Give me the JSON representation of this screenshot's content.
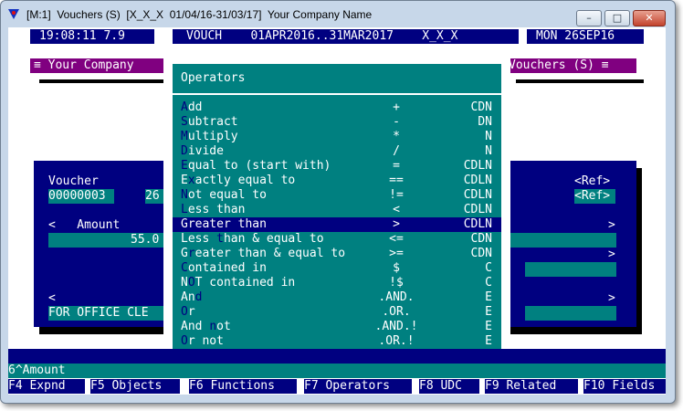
{
  "window": {
    "title": "[M:1]  Vouchers (S)  [X_X_X  01/04/16-31/03/17]  Your Company Name",
    "buttons": {
      "minimize": "–",
      "maximize": "□",
      "close": "✕"
    }
  },
  "status_bar": {
    "time": "19:08:11 7.9",
    "context": "VOUCH    01APR2016..31MAR2017    X_X_X",
    "date": "MON 26SEP16"
  },
  "company_header": "≡ Your Company",
  "vouchers_header": "Vouchers (S) ≡",
  "form": {
    "voucher_label": "Voucher",
    "voucher_value": "00000003",
    "voucher_value2": "26",
    "ref_label": "<Ref>",
    "ref_value": "<Ref>",
    "amount_label": "<   Amount",
    "amount_right": ">",
    "amount_value": "55.0",
    "row_left_arrow": "<",
    "row_right_arrow": ">",
    "office_text": "FOR OFFICE CLE"
  },
  "operators": {
    "title": "Operators",
    "items": [
      {
        "hot": "A",
        "rest": "dd",
        "symbol": "+",
        "codes": "CDN",
        "selected": false
      },
      {
        "hot": "S",
        "rest": "ubtract",
        "symbol": "-",
        "codes": "DN",
        "selected": false
      },
      {
        "hot": "M",
        "rest": "ultiply",
        "symbol": "*",
        "codes": "N",
        "selected": false
      },
      {
        "hot": "D",
        "rest": "ivide",
        "symbol": "/",
        "codes": "N",
        "selected": false
      },
      {
        "hot": "E",
        "rest": "qual to (start with)",
        "symbol": "=",
        "codes": "CDLN",
        "selected": false
      },
      {
        "pre": "E",
        "hot": "x",
        "rest": "actly equal to",
        "symbol": "==",
        "codes": "CDLN",
        "selected": false
      },
      {
        "hot": "N",
        "rest": "ot equal to",
        "symbol": "!=",
        "codes": "CDLN",
        "selected": false
      },
      {
        "hot": "L",
        "rest": "ess than",
        "symbol": "<",
        "codes": "CDLN",
        "selected": false
      },
      {
        "hot": "G",
        "rest": "reater than",
        "symbol": ">",
        "codes": "CDLN",
        "selected": true
      },
      {
        "pre": "Less ",
        "hot": "t",
        "rest": "han & equal to",
        "symbol": "<=",
        "codes": "CDN",
        "selected": false
      },
      {
        "pre": "G",
        "hot": "r",
        "rest": "eater than & equal to",
        "symbol": ">=",
        "codes": "CDN",
        "selected": false
      },
      {
        "hot": "C",
        "rest": "ontained in",
        "symbol": "$",
        "codes": "C",
        "selected": false
      },
      {
        "pre": "N",
        "hot": "O",
        "rest": "T contained in",
        "symbol": "!$",
        "codes": "C",
        "selected": false
      },
      {
        "pre": "An",
        "hot": "d",
        "rest": "",
        "symbol": ".AND.",
        "codes": "E",
        "selected": false
      },
      {
        "hot": "O",
        "rest": "r",
        "symbol": ".OR.",
        "codes": "E",
        "selected": false
      },
      {
        "pre": "And ",
        "hot": "n",
        "rest": "ot",
        "symbol": ".AND.!",
        "codes": "E",
        "selected": false
      },
      {
        "hot": "O",
        "rest": "r not",
        "symbol": ".OR.!",
        "codes": "E",
        "selected": false
      }
    ]
  },
  "bottom": {
    "field_line": "6^Amount",
    "fkeys": [
      {
        "key": "F4",
        "label": "Expnd"
      },
      {
        "key": "F5",
        "label": "Objects"
      },
      {
        "key": "F6",
        "label": "Functions"
      },
      {
        "key": "F7",
        "label": "Operators"
      },
      {
        "key": "F8",
        "label": "UDC"
      },
      {
        "key": "F9",
        "label": "Related"
      },
      {
        "key": "F10",
        "label": "Fields"
      }
    ]
  }
}
